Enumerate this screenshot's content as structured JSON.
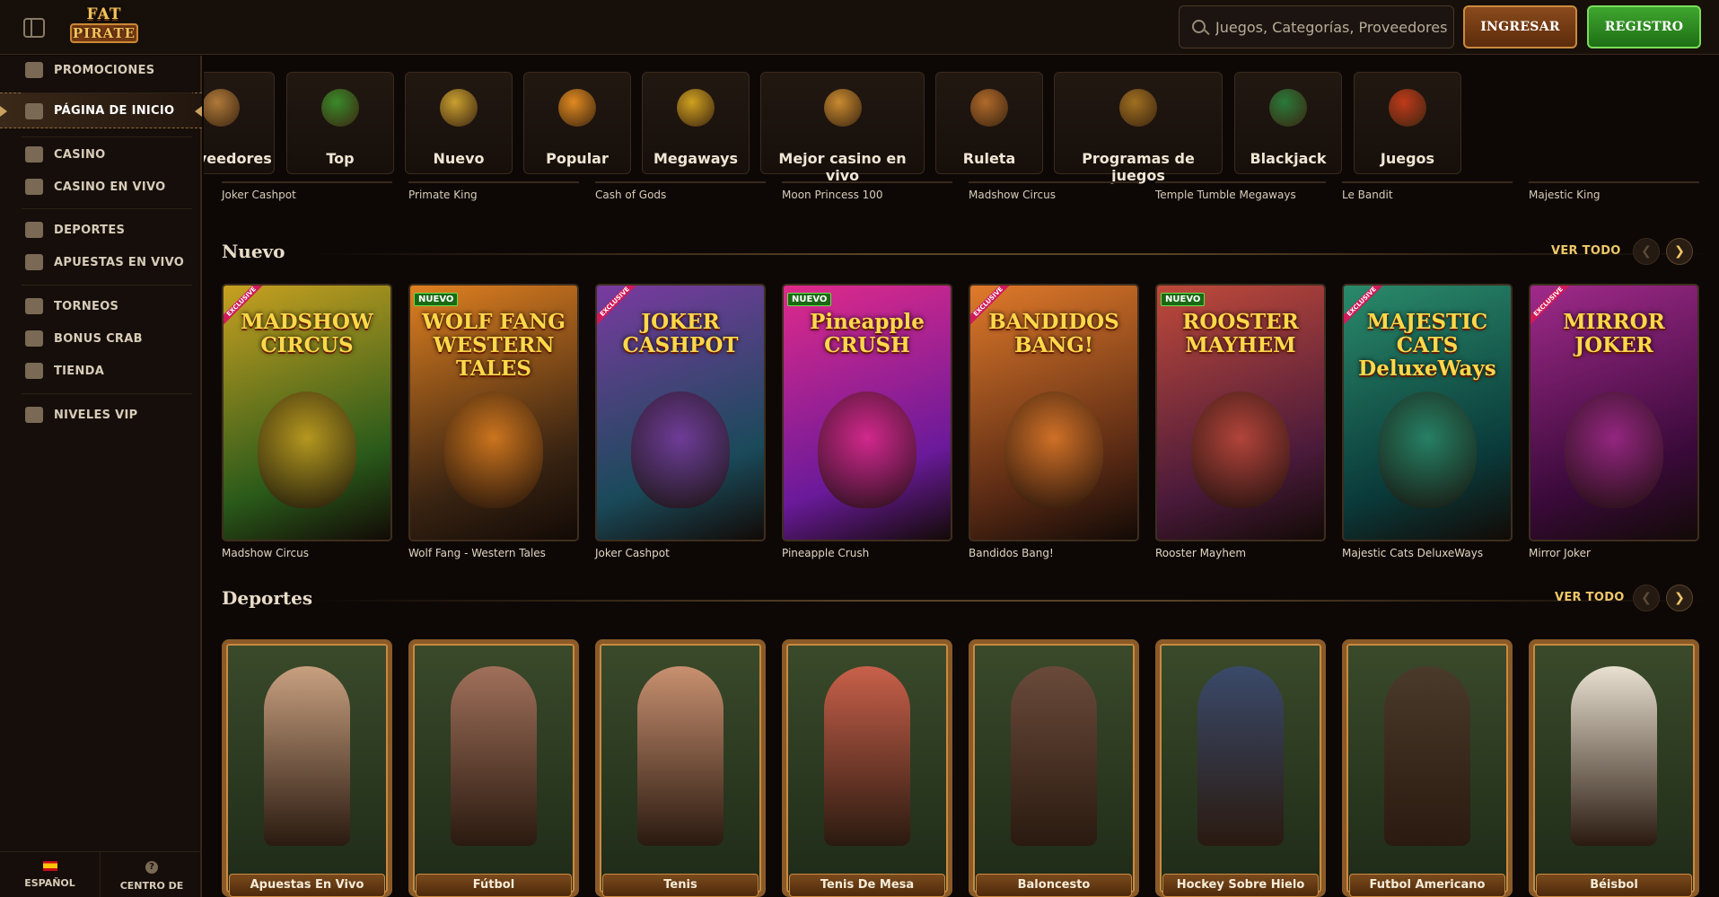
{
  "header": {
    "logo_line1": "FAT",
    "logo_line2": "PIRATE",
    "search_placeholder": "Juegos, Categorías, Proveedores",
    "login_label": "INGRESAR",
    "register_label": "REGISTRO"
  },
  "sidebar": {
    "items": [
      {
        "label": "PROMOCIONES",
        "icon": "promotions-icon"
      },
      {
        "label": "PÁGINA DE INICIO",
        "icon": "home-icon"
      },
      {
        "label": "CASINO",
        "icon": "casino-icon"
      },
      {
        "label": "CASINO EN VIVO",
        "icon": "live-casino-icon"
      },
      {
        "label": "DEPORTES",
        "icon": "sports-icon"
      },
      {
        "label": "APUESTAS EN VIVO",
        "icon": "live-bets-icon"
      },
      {
        "label": "TORNEOS",
        "icon": "trophy-icon"
      },
      {
        "label": "BONUS CRAB",
        "icon": "crab-icon"
      },
      {
        "label": "TIENDA",
        "icon": "shop-icon"
      },
      {
        "label": "NIVELES VIP",
        "icon": "diamond-icon"
      }
    ],
    "footer": {
      "language": "ESPAÑOL",
      "help": "CENTRO DE AYUDA"
    }
  },
  "categories": [
    "Proveedores",
    "Top",
    "Nuevo",
    "Popular",
    "Megaways",
    "Mejor casino en vivo",
    "Ruleta",
    "Programas de juegos",
    "Blackjack",
    "Juegos"
  ],
  "top_strip": [
    "Joker Cashpot",
    "Primate King",
    "Cash of Gods",
    "Moon Princess 100",
    "Madshow Circus",
    "Temple Tumble Megaways",
    "Le Bandit",
    "Majestic King"
  ],
  "nuevo": {
    "title": "Nuevo",
    "see_all": "VER TODO",
    "games": [
      {
        "name": "Madshow Circus",
        "art": "MADSHOW CIRCUS",
        "tag": "EXCLUSIVE",
        "colors": [
          "#2a5a1a",
          "#c8a020"
        ]
      },
      {
        "name": "Wolf Fang - Western Tales",
        "art": "WOLF FANG WESTERN TALES",
        "tag": "NUEVO",
        "colors": [
          "#3a2412",
          "#e08020"
        ]
      },
      {
        "name": "Joker Cashpot",
        "art": "JOKER CASHPOT",
        "tag": "EXCLUSIVE",
        "colors": [
          "#1a4a5a",
          "#7a3aa0"
        ]
      },
      {
        "name": "Pineapple Crush",
        "art": "Pineapple CRUSH",
        "tag": "NUEVO",
        "colors": [
          "#6a1a9a",
          "#e02a8a"
        ]
      },
      {
        "name": "Bandidos Bang!",
        "art": "BANDIDOS BANG!",
        "tag": "EXCLUSIVE",
        "colors": [
          "#5a2a14",
          "#e07a2a"
        ]
      },
      {
        "name": "Rooster Mayhem",
        "art": "ROOSTER MAYHEM",
        "tag": "NUEVO",
        "colors": [
          "#4a1a3a",
          "#c04a3a"
        ]
      },
      {
        "name": "Majestic Cats DeluxeWays",
        "art": "MAJESTIC CATS DeluxeWays",
        "tag": "EXCLUSIVE",
        "colors": [
          "#0a3a3a",
          "#2a8a6a"
        ]
      },
      {
        "name": "Mirror Joker",
        "art": "MIRROR JOKER",
        "tag": "EXCLUSIVE",
        "colors": [
          "#3a0a3a",
          "#a02a8a"
        ]
      }
    ]
  },
  "deportes": {
    "title": "Deportes",
    "see_all": "VER TODO",
    "sports": [
      "Apuestas En Vivo",
      "Fútbol",
      "Tenis",
      "Tenis De Mesa",
      "Baloncesto",
      "Hockey Sobre Hielo",
      "Futbol Americano",
      "Béisbol"
    ]
  }
}
